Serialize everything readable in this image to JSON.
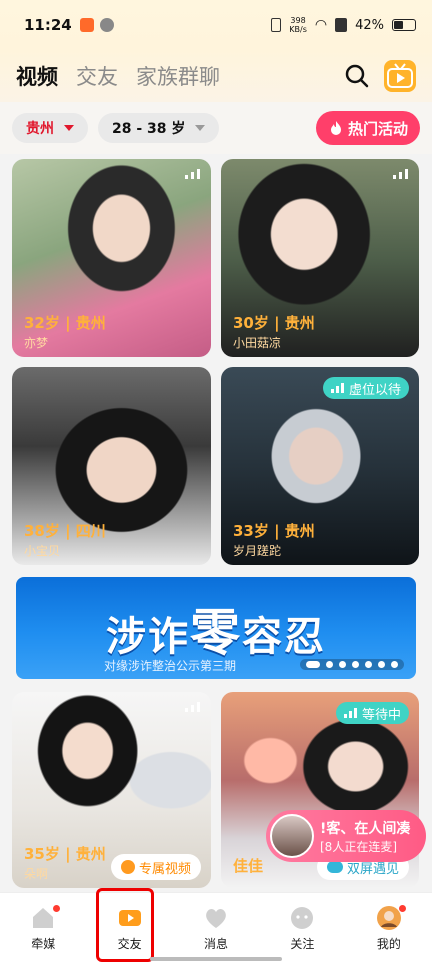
{
  "status_bar": {
    "time": "11:24",
    "net_speed_value": "398",
    "net_speed_unit": "KB/s",
    "battery": "42%"
  },
  "header": {
    "tabs": [
      {
        "label": "视频",
        "active": true
      },
      {
        "label": "交友",
        "active": false
      },
      {
        "label": "家族群聊",
        "active": false
      }
    ],
    "icons": [
      "search-icon",
      "tv-icon"
    ]
  },
  "filters": {
    "city": "贵州",
    "age_range": "28 - 38 岁",
    "hot_activity": "热门活动"
  },
  "cards": [
    {
      "age_loc": "32岁 | 贵州",
      "nick": "亦梦"
    },
    {
      "age_loc": "30岁 | 贵州",
      "nick": "小田菇凉"
    },
    {
      "age_loc": "38岁 | 四川",
      "nick": "小宝贝"
    },
    {
      "age_loc": "33岁 | 贵州",
      "nick": "岁月蹉跎",
      "badge": "虚位以待"
    },
    {
      "age_loc": "35岁 | 贵州",
      "nick": "朵啊",
      "tag": "专属视频"
    },
    {
      "name": "佳佳",
      "badge": "等待中",
      "tag": "双屏遇见"
    }
  ],
  "banner": {
    "title_a": "涉诈",
    "title_b": "零",
    "title_c": "容忍",
    "subtitle": "对缘涉诈整治公示第三期",
    "page_count": 7
  },
  "live_popup": {
    "line1": "!客、在人间凑",
    "line2": "[8人正在连麦]"
  },
  "nav": [
    {
      "label": "牵媒",
      "icon": "matchmaker-icon",
      "badge": true
    },
    {
      "label": "交友",
      "icon": "video-camera-icon",
      "badge": false,
      "active": true
    },
    {
      "label": "消息",
      "icon": "heart-message-icon",
      "badge": false
    },
    {
      "label": "关注",
      "icon": "follow-face-icon",
      "badge": false
    },
    {
      "label": "我的",
      "icon": "avatar-icon",
      "badge": true
    }
  ],
  "colors": {
    "accent_red": "#e1182d",
    "hot_pink": "#ff3f6a",
    "age_orange": "#ffb13b",
    "teal_badge": "#3fd3c5",
    "banner_blue": "#1f8ef0"
  }
}
